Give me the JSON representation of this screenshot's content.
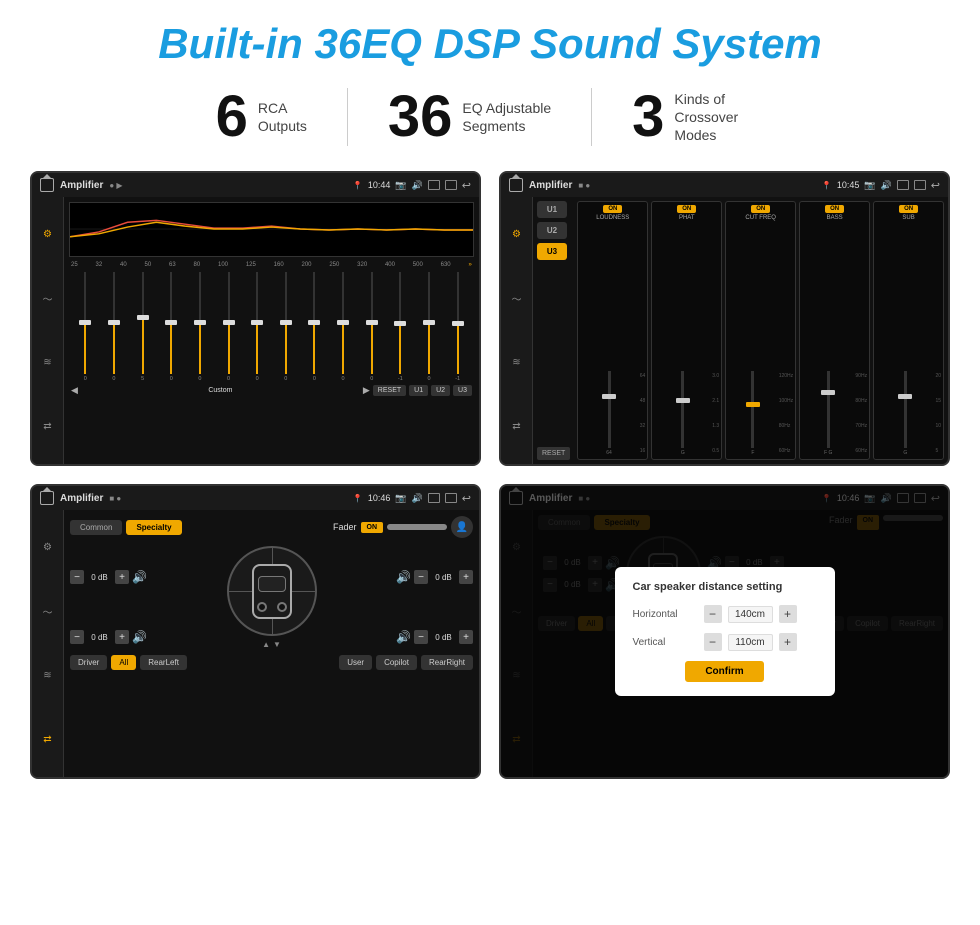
{
  "page": {
    "title": "Built-in 36EQ DSP Sound System",
    "stats": [
      {
        "number": "6",
        "label": "RCA\nOutputs"
      },
      {
        "number": "36",
        "label": "EQ Adjustable\nSegments"
      },
      {
        "number": "3",
        "label": "Kinds of\nCrossover Modes"
      }
    ]
  },
  "screen1": {
    "title": "Amplifier",
    "time": "10:44",
    "freq_labels": [
      "25",
      "32",
      "40",
      "50",
      "63",
      "80",
      "100",
      "125",
      "160",
      "200",
      "250",
      "320",
      "400",
      "500",
      "630"
    ],
    "slider_values": [
      "0",
      "0",
      "5",
      "0",
      "0",
      "0",
      "0",
      "0",
      "0",
      "0",
      "0",
      "-1",
      "0",
      "-1"
    ],
    "buttons": {
      "custom": "Custom",
      "reset": "RESET",
      "u1": "U1",
      "u2": "U2",
      "u3": "U3"
    }
  },
  "screen2": {
    "title": "Amplifier",
    "time": "10:45",
    "presets": [
      "U1",
      "U2",
      "U3"
    ],
    "channels": [
      {
        "toggle": "ON",
        "name": "LOUDNESS"
      },
      {
        "toggle": "ON",
        "name": "PHAT"
      },
      {
        "toggle": "ON",
        "name": "CUT FREQ"
      },
      {
        "toggle": "ON",
        "name": "BASS"
      },
      {
        "toggle": "ON",
        "name": "SUB"
      }
    ],
    "reset_label": "RESET"
  },
  "screen3": {
    "title": "Amplifier",
    "time": "10:46",
    "tabs": [
      "Common",
      "Specialty"
    ],
    "fader_label": "Fader",
    "fader_toggle": "ON",
    "channels_left": [
      {
        "label": "0 dB"
      },
      {
        "label": "0 dB"
      }
    ],
    "channels_right": [
      {
        "label": "0 dB"
      },
      {
        "label": "0 dB"
      }
    ],
    "bottom_buttons": [
      "Driver",
      "RearLeft",
      "All",
      "User",
      "Copilot",
      "RearRight"
    ]
  },
  "screen4": {
    "title": "Amplifier",
    "time": "10:46",
    "tabs": [
      "Common",
      "Specialty"
    ],
    "dialog": {
      "title": "Car speaker distance setting",
      "rows": [
        {
          "label": "Horizontal",
          "value": "140cm"
        },
        {
          "label": "Vertical",
          "value": "110cm"
        }
      ],
      "confirm": "Confirm"
    },
    "bottom_buttons": [
      "Driver",
      "RearLeft",
      "All",
      "User",
      "Copilot",
      "RearRight"
    ]
  }
}
